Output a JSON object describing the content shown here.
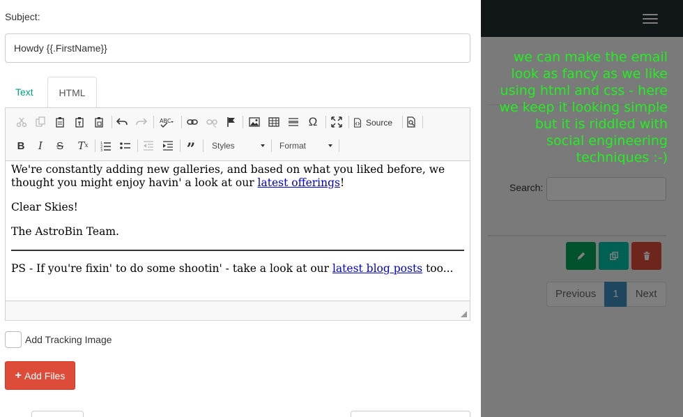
{
  "background": {
    "annotation": "we can make the email look as fancy as we like using html and css - here we keep it looking simple but it is riddled with social engineering techniques :-)",
    "search_label": "Search:",
    "pager": {
      "previous": "Previous",
      "current": "1",
      "next": "Next"
    },
    "colors": {
      "topbar": "#222d32",
      "annotation": "#22ee22",
      "edit": "#00a65a",
      "copy": "#00c0a8",
      "delete": "#dd4b39",
      "active_page": "#3c8dbc"
    }
  },
  "form": {
    "subject_label": "Subject:",
    "subject_value": "Howdy {{.FirstName}}",
    "tabs": {
      "text": "Text",
      "html": "HTML"
    },
    "toolbar": {
      "source": "Source",
      "styles": "Styles",
      "format": "Format"
    },
    "email_body": {
      "p1_before": "We're constantly adding new galleries, and based on what you liked before, we thought you might enjoy havin' a look at our ",
      "p1_link": "latest offerings",
      "p1_after": "!",
      "p2": "Clear Skies!",
      "p3": "The AstroBin Team.",
      "p4_before": "PS - If you're fixin' to do some shootin' - take a look at our ",
      "p4_link": "latest blog posts",
      "p4_after": " too..."
    },
    "tracking_label": "Add Tracking Image",
    "add_files_label": "Add Files",
    "add_files_color": "#dd4b39"
  }
}
